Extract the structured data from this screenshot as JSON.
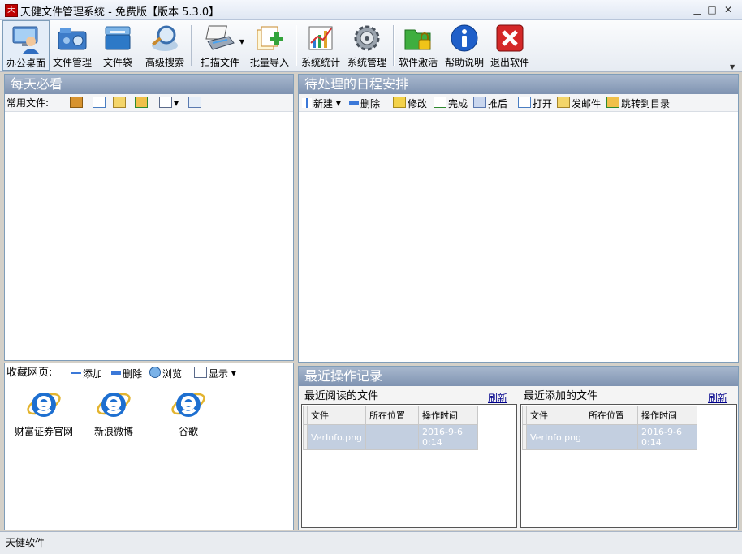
{
  "window": {
    "icon_glyph": "天",
    "title": "天健文件管理系统 - 免费版【版本 5.3.0】",
    "minimize_glyph": "▁",
    "maximize_glyph": "□",
    "close_glyph": "✕"
  },
  "toolbar": {
    "items": [
      {
        "label": "办公桌面",
        "icon": "desktop-user-icon"
      },
      {
        "label": "文件管理",
        "icon": "file-manage-icon"
      },
      {
        "label": "文件袋",
        "icon": "file-bag-icon"
      },
      {
        "label": "高级搜索",
        "icon": "advanced-search-icon"
      },
      {
        "label": "扫描文件",
        "icon": "scanner-icon"
      },
      {
        "label": "批量导入",
        "icon": "batch-import-icon"
      },
      {
        "label": "系统统计",
        "icon": "statistics-icon"
      },
      {
        "label": "系统管理",
        "icon": "system-gear-icon"
      },
      {
        "label": "软件激活",
        "icon": "activate-lock-icon"
      },
      {
        "label": "帮助说明",
        "icon": "help-info-icon"
      },
      {
        "label": "退出软件",
        "icon": "exit-icon"
      }
    ]
  },
  "left_pane": {
    "title": "每天必看",
    "common_files_label": "常用文件:"
  },
  "favorites": {
    "label": "收藏网页:",
    "add_label": "添加",
    "delete_label": "删除",
    "browse_label": "浏览",
    "display_label": "显示",
    "items": [
      "财富证券官网",
      "新浪微博",
      "谷歌"
    ]
  },
  "schedule": {
    "title": "待处理的日程安排",
    "new_label": "新建",
    "delete_label": "删除",
    "edit_label": "修改",
    "done_label": "完成",
    "postpone_label": "推后",
    "open_label": "打开",
    "mail_label": "发邮件",
    "goto_label": "跳转到目录"
  },
  "recent": {
    "title": "最近操作记录",
    "read_title": "最近阅读的文件",
    "added_title": "最近添加的文件",
    "refresh_label": "刷新",
    "columns": [
      "文件",
      "所在位置",
      "操作时间"
    ],
    "read_rows": [
      [
        "VerInfo.png",
        "",
        "2016-9-6 0:14"
      ]
    ],
    "added_rows": [
      [
        "VerInfo.png",
        "",
        "2016-9-6 0:14"
      ]
    ]
  },
  "status": {
    "text": "天健软件"
  },
  "colors": {
    "pane_header": "#8fa2be",
    "selected_row": "#c3cfe0",
    "ie_blue": "#1565c0"
  }
}
